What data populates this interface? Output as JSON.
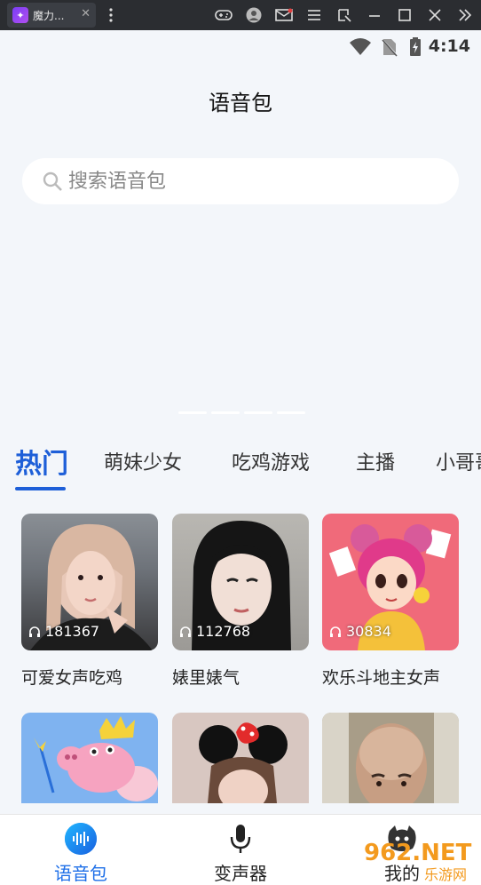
{
  "window": {
    "tab_title": "魔力...",
    "tab_close": "✕",
    "toolbar_icons": [
      "more-vert-icon",
      "gamepad-icon",
      "account-icon",
      "mail-icon",
      "menu-icon",
      "screenshot-icon",
      "minimize-icon",
      "maximize-icon",
      "close-icon",
      "expand-icon"
    ]
  },
  "status_bar": {
    "time": "4:14"
  },
  "header": {
    "title": "语音包"
  },
  "search": {
    "placeholder": "搜索语音包"
  },
  "category_tabs": [
    "热门",
    "萌妹少女",
    "吃鸡游戏",
    "主播",
    "小哥哥"
  ],
  "active_tab": "热门",
  "cards": [
    {
      "title": "可爱女声吃鸡",
      "count": "181367"
    },
    {
      "title": "婊里婊气",
      "count": "112768"
    },
    {
      "title": "欢乐斗地主女声",
      "count": "30834"
    }
  ],
  "nav": {
    "items": [
      {
        "label": "语音包"
      },
      {
        "label": "变声器"
      },
      {
        "label": "我的"
      }
    ]
  },
  "watermark": {
    "text1": "962.NET",
    "text2": "乐游网"
  },
  "colors": {
    "accent": "#1e5fd8",
    "background": "#f3f6fa"
  }
}
